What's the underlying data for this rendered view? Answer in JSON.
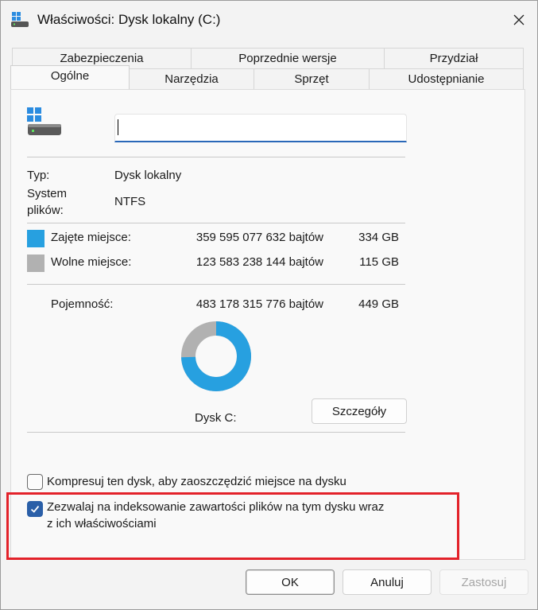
{
  "window": {
    "title": "Właściwości: Dysk lokalny (C:)",
    "close_icon": "close-icon"
  },
  "tabs": {
    "row_back": [
      "Zabezpieczenia",
      "Poprzednie wersje",
      "Przydział"
    ],
    "row_front": [
      "Ogólne",
      "Narzędzia",
      "Sprzęt",
      "Udostępnianie"
    ],
    "active": "Ogólne"
  },
  "general": {
    "name_value": "",
    "type_label": "Typ:",
    "type_value": "Dysk lokalny",
    "fs_label_1": "System",
    "fs_label_2": "plików:",
    "fs_value": "NTFS",
    "used_label": "Zajęte miejsce:",
    "used_bytes": "359 595 077 632 bajtów",
    "used_gb": "334 GB",
    "free_label": "Wolne miejsce:",
    "free_bytes": "123 583 238 144 bajtów",
    "free_gb": "115 GB",
    "capacity_label": "Pojemność:",
    "capacity_bytes": "483 178 315 776 bajtów",
    "capacity_gb": "449 GB",
    "used_fraction": 0.744,
    "drive_label": "Dysk C:",
    "details_button": "Szczegóły",
    "compress_label": "Kompresuj ten dysk, aby zaoszczędzić miejsce na dysku",
    "compress_checked": false,
    "index_label_1": "Zezwalaj na indeksowanie zawartości plików na tym dysku wraz",
    "index_label_2": "z ich właściwościami",
    "index_checked": true
  },
  "colors": {
    "used": "#27a0e0",
    "free": "#b1b1b1",
    "highlight": "#e3222a"
  },
  "buttons": {
    "ok": "OK",
    "cancel": "Anuluj",
    "apply": "Zastosuj"
  }
}
